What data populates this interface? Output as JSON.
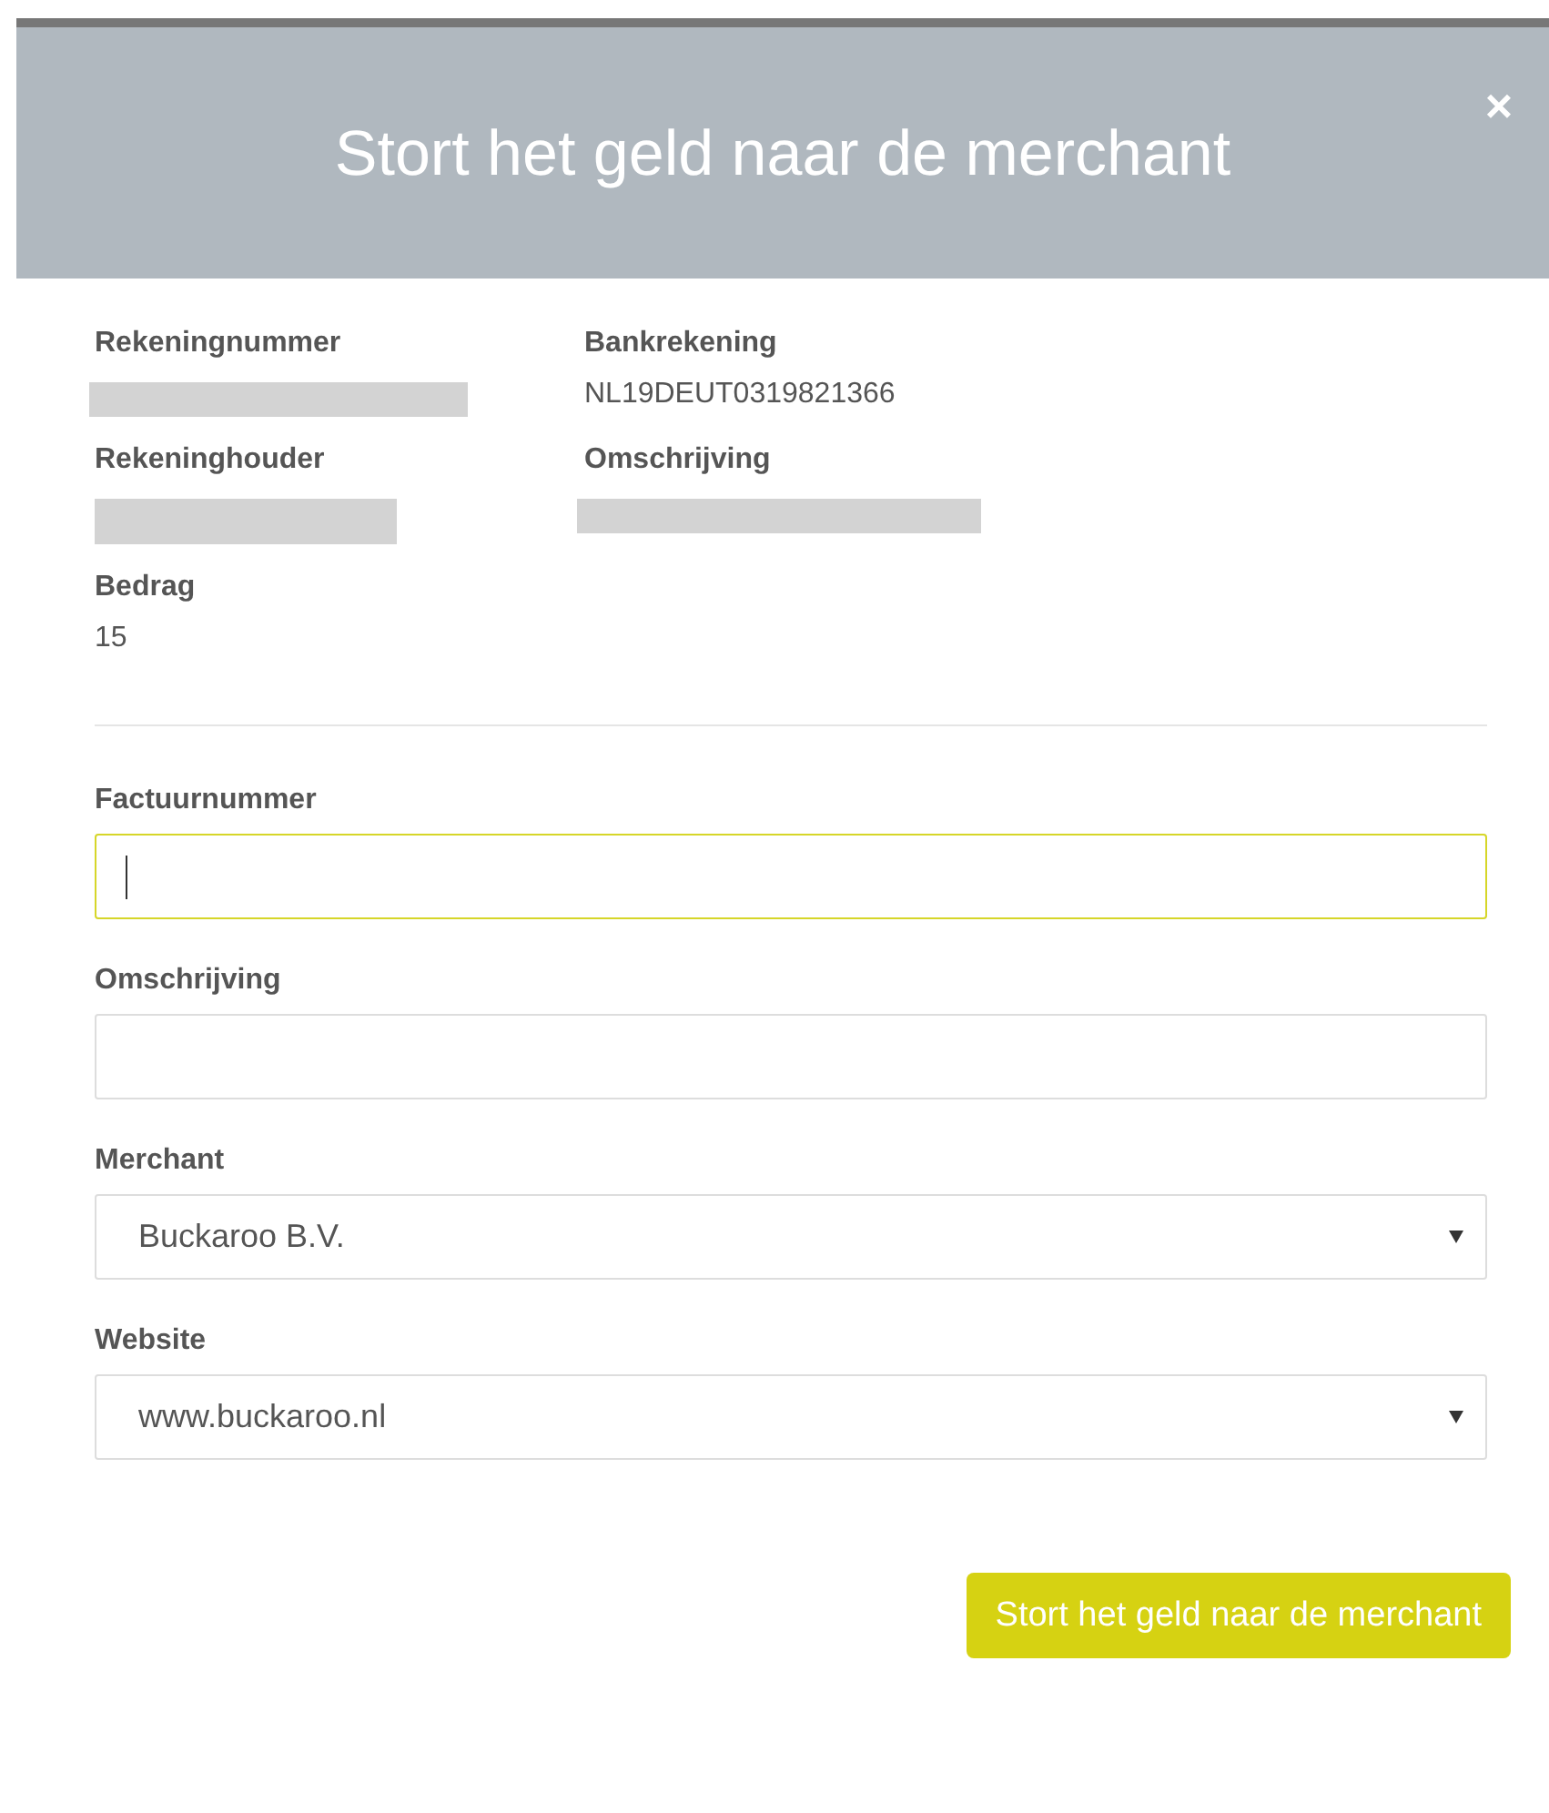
{
  "dialog": {
    "title": "Stort het geld naar de merchant",
    "close": "×"
  },
  "details": [
    {
      "label": "Rekeningnummer",
      "kind": "redacted"
    },
    {
      "label": "Bankrekening",
      "kind": "text",
      "value": "NL19DEUT0319821366"
    },
    {
      "label": "Rekeninghouder",
      "kind": "redacted"
    },
    {
      "label": "Omschrijving",
      "kind": "redacted"
    },
    {
      "label": "Bedrag",
      "kind": "text",
      "value": "15"
    }
  ],
  "form": [
    {
      "label": "Factuurnummer",
      "kind": "input",
      "focused": true
    },
    {
      "label": "Omschrijving",
      "kind": "input",
      "focused": false
    },
    {
      "label": "Merchant",
      "kind": "select",
      "value": "Buckaroo B.V.",
      "focused": false
    },
    {
      "label": "Website",
      "kind": "select",
      "value": "www.buckaroo.nl",
      "focused": false
    }
  ],
  "submit": "Stort het geld naar de merchant"
}
